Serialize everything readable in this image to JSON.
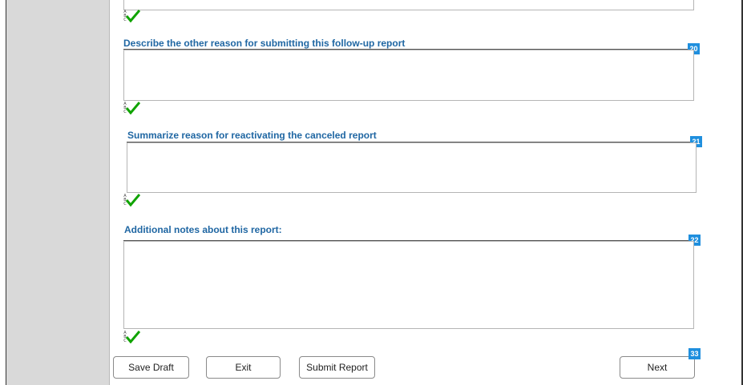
{
  "fields": [
    {
      "number": "20",
      "label": "Describe the other reason for submitting this follow-up report",
      "value": ""
    },
    {
      "number": "21",
      "label": "Summarize reason for reactivating the canceled report",
      "value": ""
    },
    {
      "number": "22",
      "label": "Additional notes about this report:",
      "value": ""
    }
  ],
  "spellcheck": {
    "glyph": "ABC",
    "icon": "spellcheck-check-icon",
    "check_color": "#0fa300"
  },
  "buttons": {
    "save_draft": "Save Draft",
    "exit": "Exit",
    "submit_report": "Submit Report",
    "next": "Next",
    "next_badge": "33"
  },
  "colors": {
    "label": "#2067a3",
    "badge": "#1f8fde",
    "sidebar": "#d9d9d9"
  }
}
